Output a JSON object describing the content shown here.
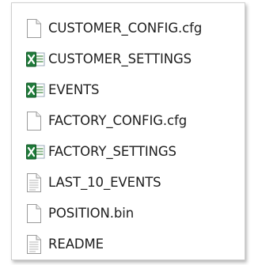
{
  "files": [
    {
      "name": "CUSTOMER_CONFIG.cfg",
      "icon": "blank-file-icon"
    },
    {
      "name": "CUSTOMER_SETTINGS",
      "icon": "excel-csv-icon"
    },
    {
      "name": "EVENTS",
      "icon": "excel-csv-icon"
    },
    {
      "name": "FACTORY_CONFIG.cfg",
      "icon": "blank-file-icon"
    },
    {
      "name": "FACTORY_SETTINGS",
      "icon": "excel-csv-icon"
    },
    {
      "name": "LAST_10_EVENTS",
      "icon": "text-file-icon"
    },
    {
      "name": "POSITION.bin",
      "icon": "blank-file-icon"
    },
    {
      "name": "README",
      "icon": "text-file-icon"
    }
  ],
  "colors": {
    "excel_green": "#1f7a3a",
    "page_border": "#9a9a9a",
    "text": "#1e1e1e"
  }
}
